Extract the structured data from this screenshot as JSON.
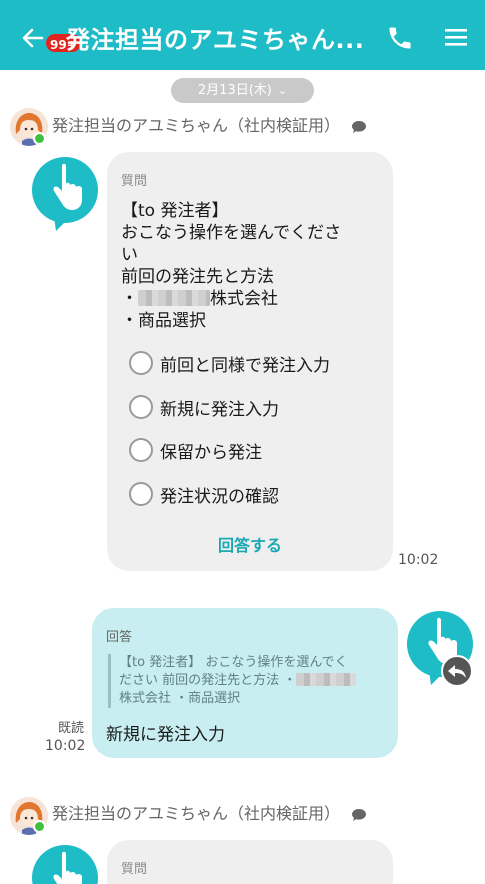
{
  "header": {
    "badge": "99+",
    "title": "発注担当のアユミちゃん..."
  },
  "date_separator": "2月13日(木)",
  "messages": [
    {
      "sender": "発注担当のアユミちゃん（社内検証用）",
      "label": "質問",
      "lines": [
        "【to 発注者】",
        "おこなう操作を選んでくださ",
        "い",
        "前回の発注先と方法"
      ],
      "company_suffix": "株式会社",
      "product_line": "・商品選択",
      "bullet": "・",
      "options": [
        "前回と同様で発注入力",
        "新規に発注入力",
        "保留から発注",
        "発注状況の確認"
      ],
      "answer_button": "回答する",
      "time": "10:02"
    }
  ],
  "reply": {
    "label": "回答",
    "quote_1": "【to 発注者】 おこなう操作を選んでく",
    "quote_2": "ださい 前回の発注先と方法 ・",
    "quote_3": "株式会社 ・商品選択",
    "answer": "新規に発注入力",
    "read_status": "既読",
    "time": "10:02"
  },
  "next_message": {
    "sender": "発注担当のアユミちゃん（社内検証用）",
    "label": "質問"
  },
  "colors": {
    "accent": "#1ebcc6",
    "badge": "#e0251f",
    "online": "#3fc13f",
    "reply_bubble": "#c8eef1",
    "question_bubble": "#efefef"
  },
  "icons": [
    "back-arrow-icon",
    "phone-icon",
    "menu-icon",
    "chevron-down-icon",
    "chat-bubble-icon",
    "pointing-hand-icon",
    "reply-icon"
  ]
}
